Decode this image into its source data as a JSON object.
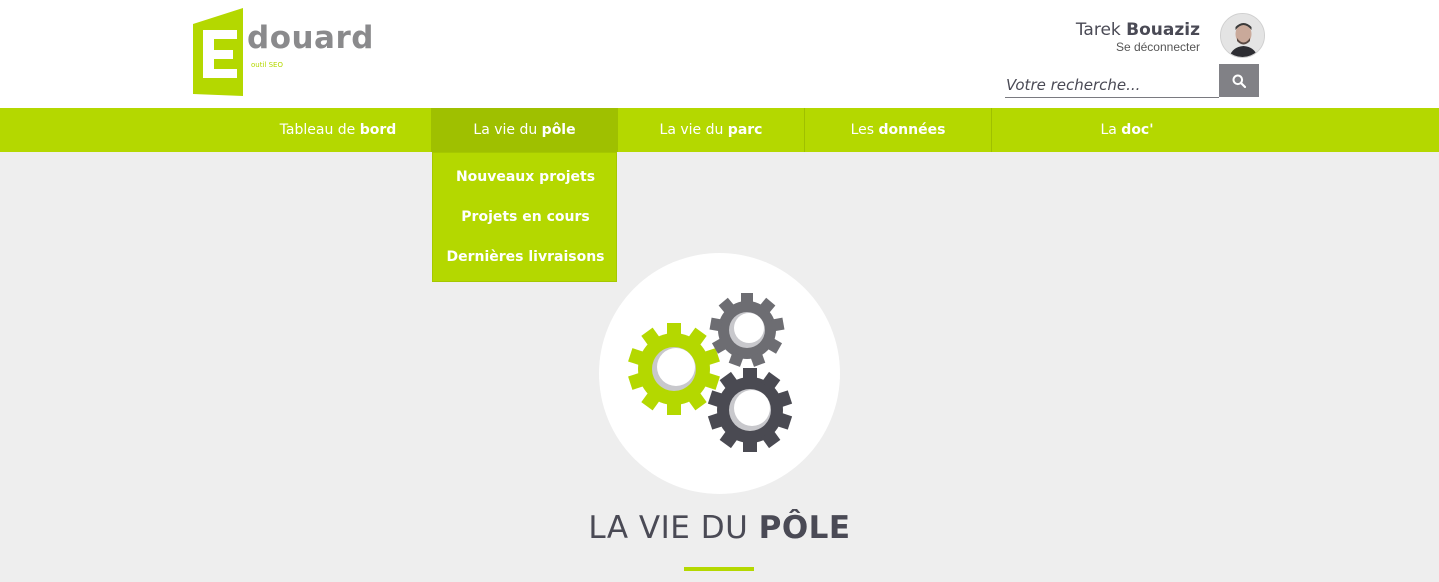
{
  "brand": {
    "word": "douard",
    "letter": "E",
    "tagline": "outil SEO"
  },
  "user": {
    "first_name": "Tarek",
    "last_name": "Bouaziz",
    "logout_label": "Se déconnecter"
  },
  "search": {
    "placeholder": "Votre recherche...",
    "icon": "search-icon"
  },
  "nav": {
    "items": [
      {
        "pre": "Tableau de ",
        "bold": "bord"
      },
      {
        "pre": "La vie du ",
        "bold": "pôle"
      },
      {
        "pre": "La vie du ",
        "bold": "parc"
      },
      {
        "pre": "Les ",
        "bold": "données"
      },
      {
        "pre": "La ",
        "bold": "doc'"
      }
    ],
    "dropdown": [
      "Nouveaux projets",
      "Projets en cours",
      "Dernières livraisons"
    ]
  },
  "hero": {
    "icon": "gears-icon",
    "title_pre": "LA VIE DU ",
    "title_bold": "PÔLE"
  },
  "colors": {
    "accent": "#b4d800",
    "accent_dark": "#9fc000",
    "text": "#4a4a55",
    "gear_grey": "#6d6d72",
    "gear_dark": "#4a4a52"
  }
}
